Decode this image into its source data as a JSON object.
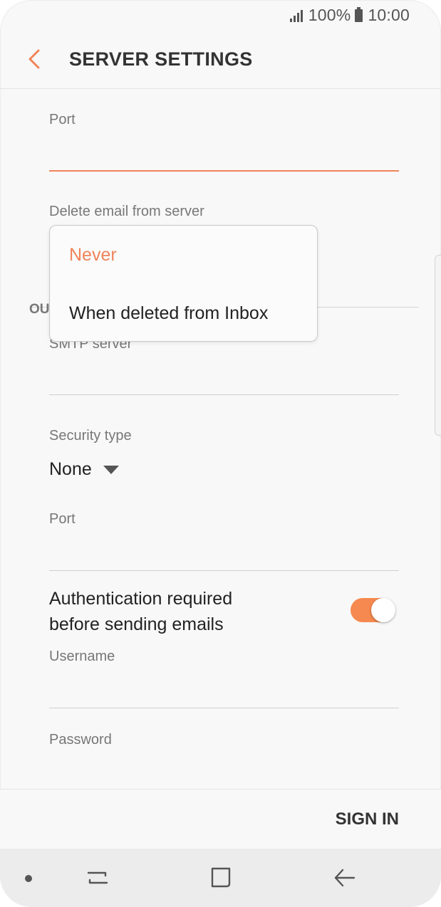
{
  "status_bar": {
    "battery_text": "100%",
    "time": "10:00"
  },
  "header": {
    "title": "SERVER SETTINGS"
  },
  "incoming": {
    "port_label": "Port",
    "delete_label": "Delete email from server"
  },
  "outgoing": {
    "section_heading": "OU",
    "smtp_label": "SMTP server",
    "security_label": "Security type",
    "security_value": "None",
    "port_label": "Port",
    "auth_line1": "Authentication required",
    "auth_line2": "before sending emails",
    "auth_enabled": true,
    "username_label": "Username",
    "password_label": "Password"
  },
  "dropdown": {
    "options": [
      "Never",
      "When deleted from Inbox"
    ],
    "selected_index": 0
  },
  "footer": {
    "sign_in_label": "SIGN IN"
  },
  "colors": {
    "accent": "#f0845a",
    "toggle_on": "#f5894f",
    "text": "#222222",
    "label": "#777777"
  },
  "icons": {
    "back": "back-arrow-icon",
    "recent_apps": "recent-apps-icon",
    "home": "home-icon",
    "nav_back": "nav-back-icon"
  }
}
